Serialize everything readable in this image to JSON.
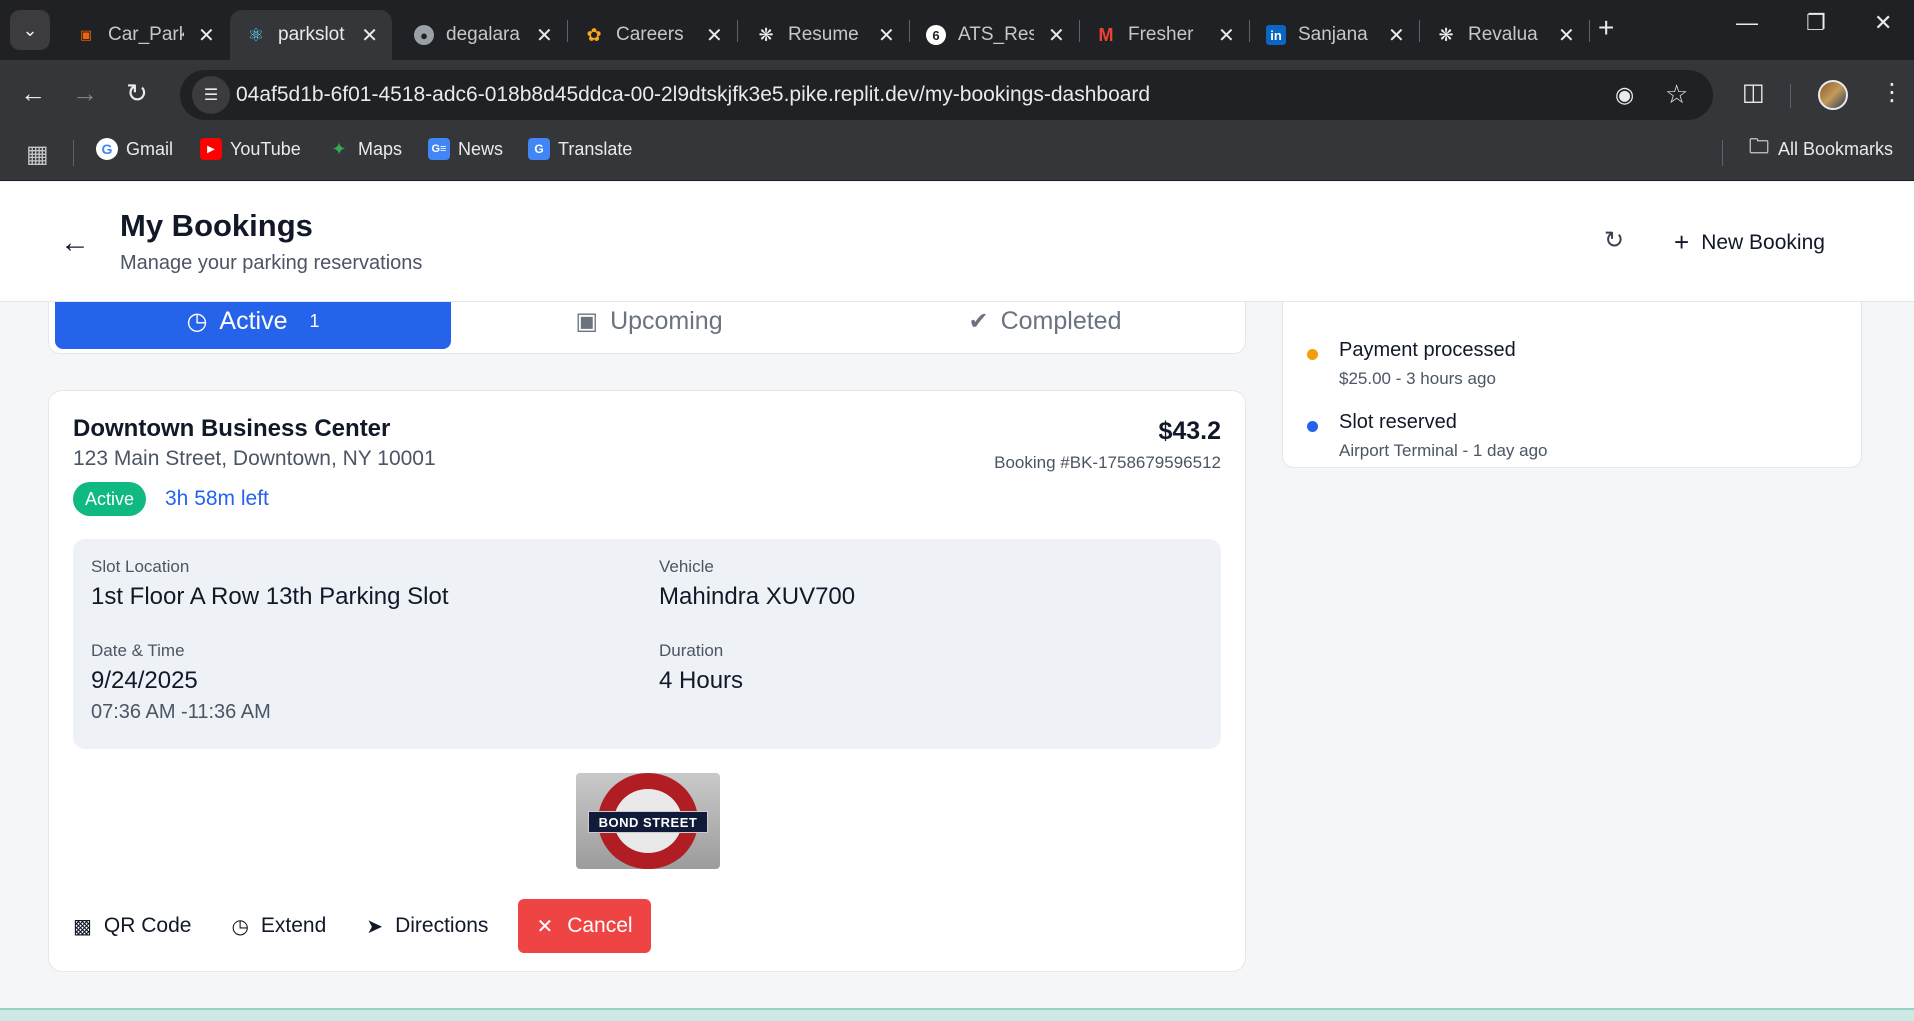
{
  "browser": {
    "tabs": [
      {
        "label": "Car_Parki",
        "favicon": "replit-icon",
        "color": "#f26207"
      },
      {
        "label": "parkslot",
        "favicon": "react-icon",
        "color": "#61dafb",
        "active": true
      },
      {
        "label": "degalara",
        "favicon": "github-icon",
        "color": "#9aa0a6"
      },
      {
        "label": "Careers",
        "favicon": "wipro-icon",
        "color": "#f6a623"
      },
      {
        "label": "Resume",
        "favicon": "openai-icon",
        "color": "#e8eaed"
      },
      {
        "label": "ATS_Res",
        "favicon": "g6-icon",
        "color": "#ffffff"
      },
      {
        "label": "Fresher",
        "favicon": "gmail-icon",
        "color": "#ea4335"
      },
      {
        "label": "Sanjana",
        "favicon": "linkedin-icon",
        "color": "#0a66c2"
      },
      {
        "label": "Revalua",
        "favicon": "openai-icon",
        "color": "#e8eaed"
      }
    ],
    "url": "04af5d1b-6f01-4518-adc6-018b8d45ddca-00-2l9dtskjfk3e5.pike.replit.dev/my-bookings-dashboard",
    "bookmarks": [
      {
        "label": "Gmail",
        "icon": "google-icon"
      },
      {
        "label": "YouTube",
        "icon": "youtube-icon"
      },
      {
        "label": "Maps",
        "icon": "maps-icon"
      },
      {
        "label": "News",
        "icon": "news-icon"
      },
      {
        "label": "Translate",
        "icon": "translate-icon"
      }
    ],
    "all_bookmarks": "All Bookmarks"
  },
  "header": {
    "title": "My Bookings",
    "subtitle": "Manage your parking reservations",
    "new_booking": "New Booking"
  },
  "tabs": {
    "active": {
      "label": "Active",
      "count": "1"
    },
    "upcoming": {
      "label": "Upcoming"
    },
    "completed": {
      "label": "Completed"
    }
  },
  "booking": {
    "name": "Downtown Business Center",
    "address": "123 Main Street, Downtown, NY 10001",
    "status": "Active",
    "time_left": "3h 58m left",
    "price": "$43.2",
    "booking_id": "Booking #BK-1758679596512",
    "slot_label": "Slot Location",
    "slot_value": "1st Floor A Row 13th Parking Slot",
    "vehicle_label": "Vehicle",
    "vehicle_value": "Mahindra XUV700",
    "datetime_label": "Date & Time",
    "date_value": "9/24/2025",
    "time_value": "07:36 AM -11:36 AM",
    "duration_label": "Duration",
    "duration_value": "4 Hours",
    "sign_text": "BOND STREET"
  },
  "actions": {
    "qr": "QR Code",
    "extend": "Extend",
    "directions": "Directions",
    "cancel": "Cancel"
  },
  "activity": [
    {
      "title": "Payment processed",
      "sub": "$25.00 - 3 hours ago",
      "color": "#f59e0b"
    },
    {
      "title": "Slot reserved",
      "sub": "Airport Terminal - 1 day ago",
      "color": "#2563eb"
    }
  ]
}
